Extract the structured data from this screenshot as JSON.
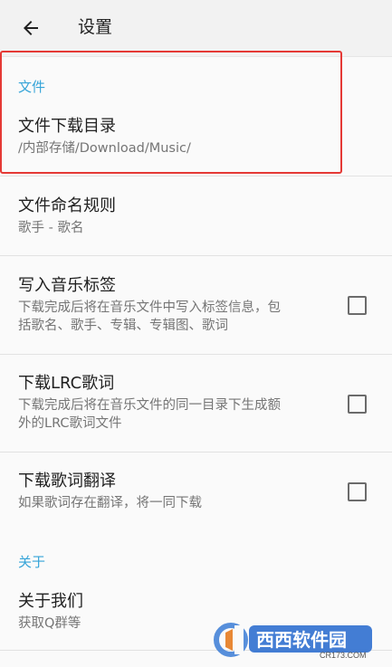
{
  "toolbar": {
    "title": "设置",
    "back_icon": "arrow-left-icon"
  },
  "sections": {
    "file": {
      "category": "文件",
      "download_dir": {
        "title": "文件下载目录",
        "summary": "/内部存储/Download/Music/"
      },
      "naming_rule": {
        "title": "文件命名规则",
        "summary": "歌手 - 歌名"
      },
      "write_tags": {
        "title": "写入音乐标签",
        "summary_line1": "下载完成后将在音乐文件中写入标签信息，包",
        "summary_line2": "括歌名、歌手、专辑、专辑图、歌词",
        "checked": false
      },
      "download_lrc": {
        "title": "下载LRC歌词",
        "summary_line1": "下载完成后将在音乐文件的同一目录下生成额",
        "summary_line2": "外的LRC歌词文件",
        "checked": false
      },
      "download_translation": {
        "title": "下载歌词翻译",
        "summary": "如果歌词存在翻译，将一同下载",
        "checked": false
      }
    },
    "about": {
      "category": "关于",
      "about_us": {
        "title": "关于我们",
        "summary": "获取Q群等"
      }
    }
  },
  "watermark": {
    "text": "西西软件园",
    "sub": "CR173.COM"
  },
  "colors": {
    "accent": "#35a4d8",
    "highlight": "#e53935",
    "toolbar_bg": "#f2f2f2",
    "page_bg": "#fafafa"
  }
}
